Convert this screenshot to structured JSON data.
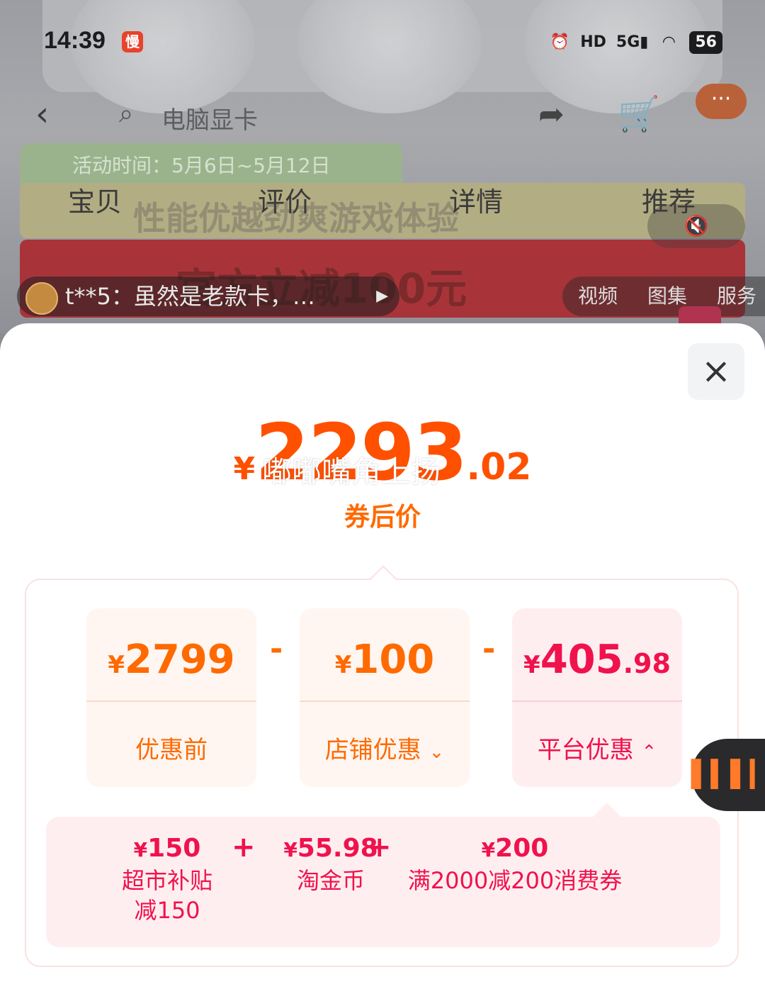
{
  "status_bar": {
    "time": "14:39",
    "app_badge": "慢",
    "icons": [
      "alarm-icon",
      "hd-icon",
      "5g-signal-icon",
      "wifi-icon"
    ],
    "hd_label": "HD",
    "network_label": "5G",
    "battery": "56"
  },
  "nav": {
    "search_text": "电脑显卡"
  },
  "background_banner": {
    "activity_time": "活动时间：5月6日~5月12日",
    "slogan": "性能优越劲爽游戏体验",
    "promo": "官方立减100元"
  },
  "tabs": [
    "宝贝",
    "评价",
    "详情",
    "推荐"
  ],
  "comment": {
    "user": "t**5",
    "text": "t**5：虽然是老款卡，…"
  },
  "media_tabs": [
    "视频",
    "图集",
    "服务"
  ],
  "sheet": {
    "price": {
      "currency": "¥",
      "integer": "2293",
      "decimal": ".02",
      "label": "券后价"
    },
    "watermark": "嘟嘟嘴角上扬",
    "breakdown": {
      "original": {
        "currency": "¥",
        "amount": "2799",
        "decimal": "",
        "label": "优惠前"
      },
      "minus1": "-",
      "shop": {
        "currency": "¥",
        "amount": "100",
        "decimal": "",
        "label": "店铺优惠"
      },
      "minus2": "-",
      "platform": {
        "currency": "¥",
        "amount": "405",
        "decimal": ".98",
        "label": "平台优惠"
      }
    },
    "platform_details": [
      {
        "currency": "¥",
        "amount": "150",
        "desc_line1": "超市补贴",
        "desc_line2": "减150"
      },
      {
        "currency": "¥",
        "amount": "55.98",
        "desc_line1": "淘金币",
        "desc_line2": ""
      },
      {
        "currency": "¥",
        "amount": "200",
        "desc_line1": "满2000减200消费券",
        "desc_line2": ""
      }
    ],
    "plus": "+"
  },
  "colors": {
    "accent_orange": "#ff5000",
    "accent_red": "#f0124d",
    "card_bg_orange": "#fff6f1",
    "card_bg_pink": "#ffeef0"
  }
}
